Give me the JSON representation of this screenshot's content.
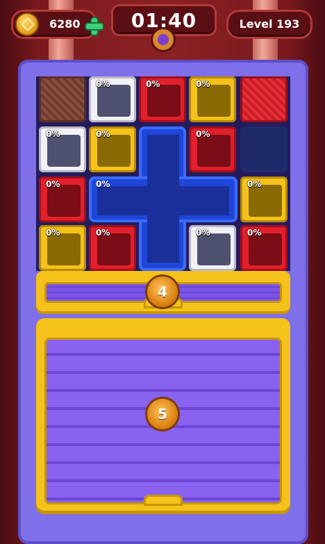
{
  "hud": {
    "coins": "6280",
    "timer": "01:40",
    "level": "Level 193"
  },
  "grid": {
    "cells": [
      {
        "color": "brown",
        "pct": ""
      },
      {
        "color": "white",
        "pct": "0%"
      },
      {
        "color": "red",
        "pct": "0%"
      },
      {
        "color": "yellow",
        "pct": "0%"
      },
      {
        "color": "redfill",
        "pct": ""
      },
      {
        "color": "white",
        "pct": "0%"
      },
      {
        "color": "yellow",
        "pct": "0%"
      },
      {
        "color": "red",
        "pct": "0%"
      },
      {
        "color": "red",
        "pct": "0%"
      },
      {
        "color": "yellow",
        "pct": "0%"
      },
      {
        "color": "yellow",
        "pct": "0%"
      },
      {
        "color": "red",
        "pct": "0%"
      },
      {
        "color": "white",
        "pct": "0%"
      },
      {
        "color": "red",
        "pct": "0%"
      }
    ],
    "blue_piece_pct": "0%"
  },
  "drawers": {
    "top_count": "4",
    "big_count": "5"
  }
}
